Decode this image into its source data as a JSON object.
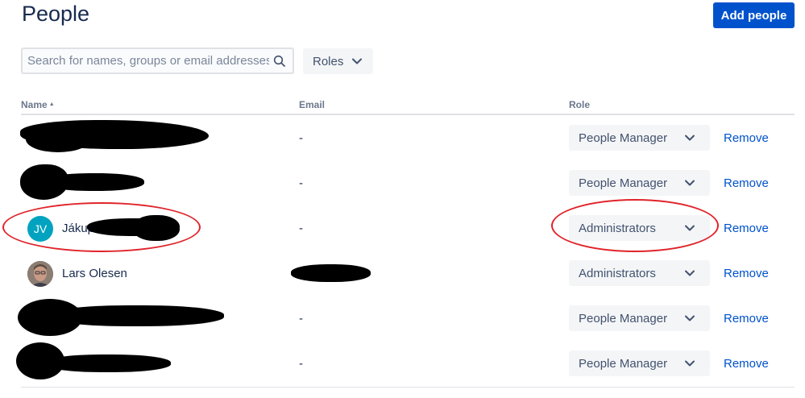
{
  "header": {
    "title": "People",
    "add_button_label": "Add people"
  },
  "search": {
    "placeholder": "Search for names, groups or email addresses",
    "value": ""
  },
  "filters": {
    "roles_label": "Roles"
  },
  "table": {
    "columns": {
      "name": "Name",
      "email": "Email",
      "role": "Role"
    },
    "sort": {
      "column": "Name",
      "direction": "ascending"
    },
    "remove_label": "Remove",
    "rows": [
      {
        "name": "",
        "email": "-",
        "role": "People Manager",
        "redacted_name": true
      },
      {
        "name": "",
        "email": "-",
        "role": "People Manager",
        "redacted_name": true
      },
      {
        "name": "Jákup",
        "avatar_initials": "JV",
        "email": "-",
        "role": "Administrators",
        "redacted_name": true
      },
      {
        "name": "Lars Olesen",
        "email": "",
        "role": "Administrators",
        "redacted_email": true
      },
      {
        "name": "",
        "email": "-",
        "role": "People Manager",
        "redacted_name": true
      },
      {
        "name": "",
        "email": "-",
        "role": "People Manager",
        "redacted_name": true
      }
    ]
  },
  "colors": {
    "primary": "#0052cc",
    "text": "#172b4d",
    "muted": "#6b778c",
    "annotation": "#e0242a",
    "avatar_jv": "#00a3bf"
  },
  "icons": {
    "search": "search-icon",
    "dropdown": "chevron-down-icon"
  }
}
